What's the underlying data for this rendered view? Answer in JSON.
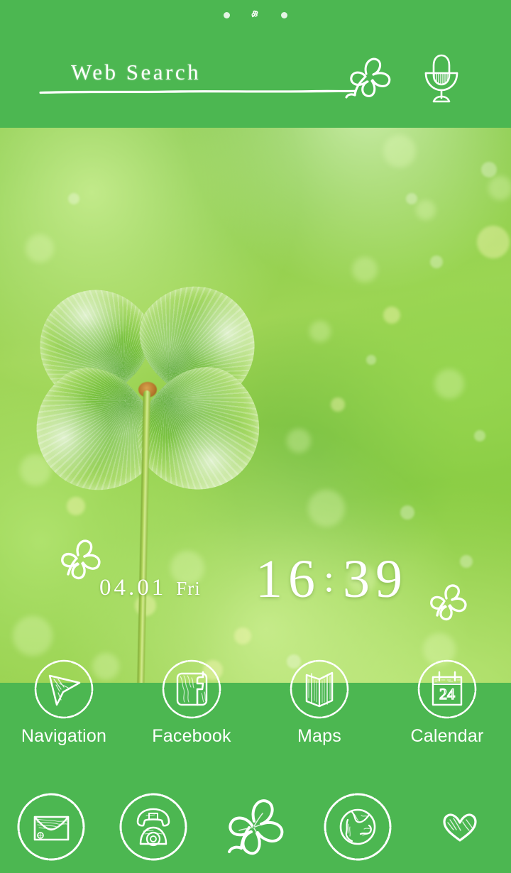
{
  "theme": {
    "name": "Four-Leaf Clover",
    "panel_green": "#4cb751",
    "text_color": "#ffffff",
    "wallpaper_subject": "four-leaf-clover-photo"
  },
  "status": {
    "page_indicator": {
      "total_pages": 3,
      "current_page": 2,
      "active_glyph": "clover-icon",
      "inactive_glyph": "dot-icon"
    }
  },
  "search": {
    "label": "Web Search",
    "placeholder": "Web Search",
    "value": "",
    "decoration_icon": "clover-icon",
    "voice_icon": "microphone-icon"
  },
  "clock": {
    "date": "04.01",
    "weekday": "Fri",
    "hours": "16",
    "separator": ":",
    "minutes": "39",
    "time": "16:39",
    "decoration_left_icon": "clover-icon",
    "decoration_right_icon": "clover-icon"
  },
  "apps": [
    {
      "label": "Navigation",
      "icon": "navigation-arrow-icon"
    },
    {
      "label": "Facebook",
      "icon": "facebook-icon"
    },
    {
      "label": "Maps",
      "icon": "folded-map-icon"
    },
    {
      "label": "Calendar",
      "icon": "calendar-icon",
      "badge": "24"
    }
  ],
  "dock": [
    {
      "name": "Mail",
      "icon": "envelope-icon"
    },
    {
      "name": "Phone",
      "icon": "telephone-icon"
    },
    {
      "name": "App Drawer",
      "icon": "clover-icon"
    },
    {
      "name": "Browser",
      "icon": "globe-icon"
    },
    {
      "name": "Favorites",
      "icon": "heart-icon"
    }
  ]
}
